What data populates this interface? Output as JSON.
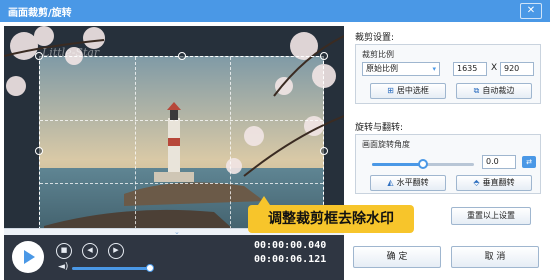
{
  "window": {
    "title": "画面裁剪/旋转",
    "close_label": "✕"
  },
  "preview": {
    "watermark_text": "Little-Star",
    "overlay_text": "调整裁剪框去除水印",
    "scroll_arrow": "⌄"
  },
  "playback": {
    "play_icon": "play-icon",
    "stop_label": "■",
    "prev_label": "◀",
    "next_label": "▶",
    "volume_icon": "◄)",
    "volume_level": 0.92,
    "current_time": "00:00:00.040",
    "total_time": "00:00:06.121"
  },
  "crop": {
    "section_title": "裁剪设置:",
    "ratio_label": "裁剪比例",
    "ratio_value": "原始比例",
    "ratio_arrow": "▾",
    "width": "1635",
    "height": "920",
    "times": "X",
    "center_label": "居中选框",
    "auto_label": "自动裁边"
  },
  "rotate": {
    "section_title": "旋转与翻转:",
    "angle_label": "画面旋转角度",
    "angle_value": "0.0",
    "angle_level": 0.5,
    "flip_h_label": "水平翻转",
    "flip_v_label": "垂直翻转",
    "spin_label": "⇄"
  },
  "footer": {
    "reset_label": "重置以上设置",
    "ok_label": "确 定",
    "cancel_label": "取 消"
  }
}
